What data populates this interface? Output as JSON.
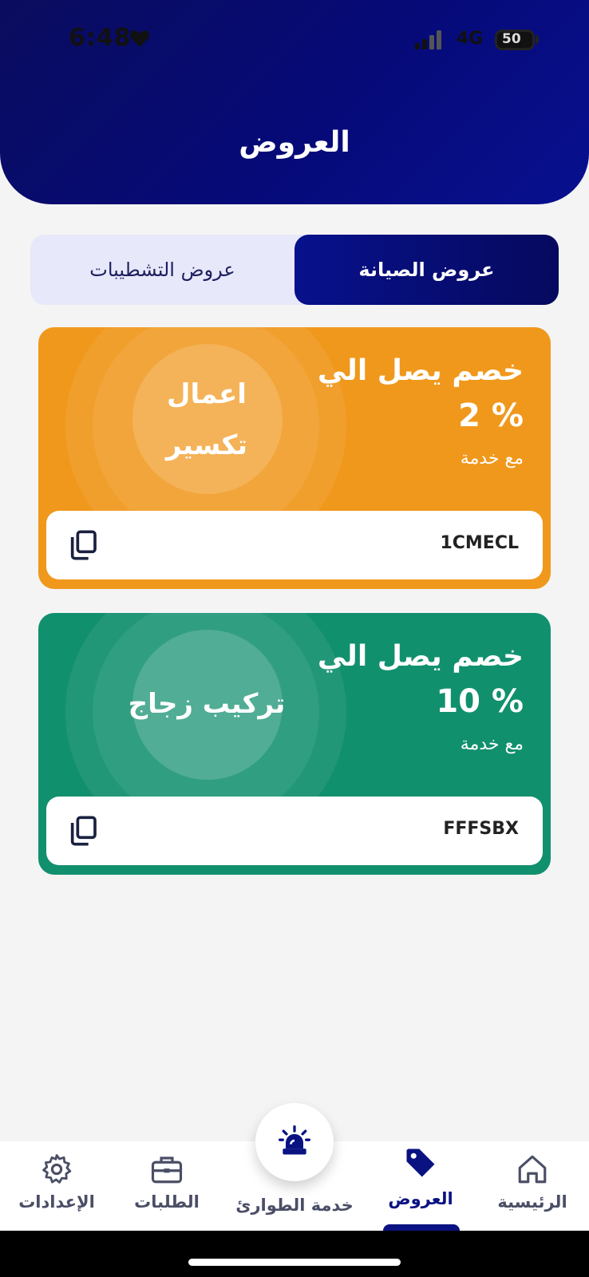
{
  "status_bar": {
    "time": "6:48",
    "network": "4G",
    "battery": "50"
  },
  "header": {
    "title": "العروض"
  },
  "tabs": [
    {
      "label": "عروض الصيانة",
      "active": true
    },
    {
      "label": "عروض التشطيبات",
      "active": false
    }
  ],
  "offers": [
    {
      "service_line1": "اعمال",
      "service_line2": "تكسير",
      "discount_title": "خصم يصل الي",
      "discount_value": "2 %",
      "discount_sub": "مع خدمة",
      "code": "1CMECL",
      "color": "#f0981c"
    },
    {
      "service_line1": "تركيب زجاج",
      "service_line2": "",
      "discount_title": "خصم يصل الي",
      "discount_value": "10 %",
      "discount_sub": "مع خدمة",
      "code": "FFFSBX",
      "color": "#11906e"
    }
  ],
  "bottom_nav": {
    "home": "الرئيسية",
    "offers": "العروض",
    "emergency": "خدمة الطوارئ",
    "orders": "الطلبات",
    "settings": "الإعدادات",
    "active": "offers"
  },
  "colors": {
    "primary": "#0a1282",
    "orange": "#f0981c",
    "green": "#11906e"
  }
}
